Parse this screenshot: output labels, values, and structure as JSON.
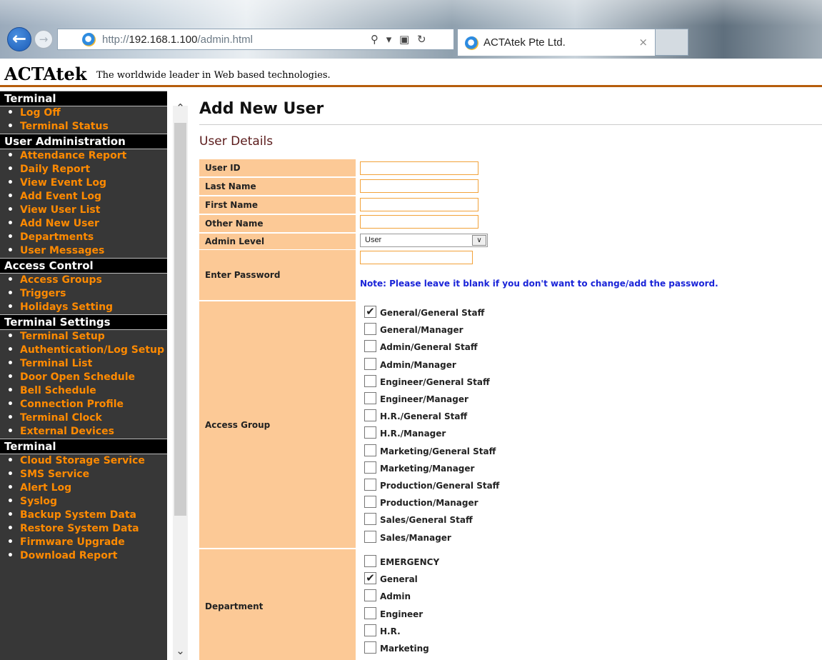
{
  "browser": {
    "url_prefix": "http://",
    "url_host": "192.168.1.100",
    "url_path": "/admin.html",
    "tab_title": "ACTAtek Pte Ltd.",
    "tab_close": "×"
  },
  "header": {
    "brand": "ACTAtek",
    "tagline": "The worldwide leader in Web based technologies."
  },
  "sidebar": {
    "sections": [
      {
        "title": "Terminal",
        "items": [
          "Log Off",
          "Terminal Status"
        ]
      },
      {
        "title": "User Administration",
        "items": [
          "Attendance Report",
          "Daily Report",
          "View Event Log",
          "Add Event Log",
          "View User List",
          "Add New User",
          "Departments",
          "User Messages"
        ]
      },
      {
        "title": "Access Control",
        "items": [
          "Access Groups",
          "Triggers",
          "Holidays Setting"
        ]
      },
      {
        "title": "Terminal Settings",
        "items": [
          "Terminal Setup",
          "Authentication/Log Setup",
          "Terminal List",
          "Door Open Schedule",
          "Bell Schedule",
          "Connection Profile",
          "Terminal Clock",
          "External Devices"
        ]
      },
      {
        "title": "Terminal",
        "items": [
          "Cloud Storage Service",
          "SMS Service",
          "Alert Log",
          "Syslog",
          "Backup System Data",
          "Restore System Data",
          "Firmware Upgrade",
          "Download Report"
        ]
      }
    ]
  },
  "main": {
    "title": "Add New User",
    "section": "User Details",
    "fields": {
      "user_id": {
        "label": "User ID",
        "value": ""
      },
      "last_name": {
        "label": "Last Name",
        "value": ""
      },
      "first_name": {
        "label": "First Name",
        "value": ""
      },
      "other_name": {
        "label": "Other Name",
        "value": ""
      },
      "admin_level": {
        "label": "Admin Level",
        "value": "User"
      },
      "password": {
        "label": "Enter Password",
        "value": "",
        "note": "Note: Please leave it blank if you don't want to change/add the password."
      }
    },
    "access_group": {
      "label": "Access Group",
      "options": [
        {
          "label": "General/General Staff",
          "checked": true
        },
        {
          "label": "General/Manager",
          "checked": false
        },
        {
          "label": "Admin/General Staff",
          "checked": false
        },
        {
          "label": "Admin/Manager",
          "checked": false
        },
        {
          "label": "Engineer/General Staff",
          "checked": false
        },
        {
          "label": "Engineer/Manager",
          "checked": false
        },
        {
          "label": "H.R./General Staff",
          "checked": false
        },
        {
          "label": "H.R./Manager",
          "checked": false
        },
        {
          "label": "Marketing/General Staff",
          "checked": false
        },
        {
          "label": "Marketing/Manager",
          "checked": false
        },
        {
          "label": "Production/General Staff",
          "checked": false
        },
        {
          "label": "Production/Manager",
          "checked": false
        },
        {
          "label": "Sales/General Staff",
          "checked": false
        },
        {
          "label": "Sales/Manager",
          "checked": false
        }
      ]
    },
    "department": {
      "label": "Department",
      "options": [
        {
          "label": "EMERGENCY",
          "checked": false
        },
        {
          "label": "General",
          "checked": true
        },
        {
          "label": "Admin",
          "checked": false
        },
        {
          "label": "Engineer",
          "checked": false
        },
        {
          "label": "H.R.",
          "checked": false
        },
        {
          "label": "Marketing",
          "checked": false
        }
      ]
    }
  },
  "colors": {
    "accent": "#ff8a00",
    "label_bg": "#fcc996",
    "header_rule": "#b65d0c",
    "note": "#1a24d8"
  }
}
